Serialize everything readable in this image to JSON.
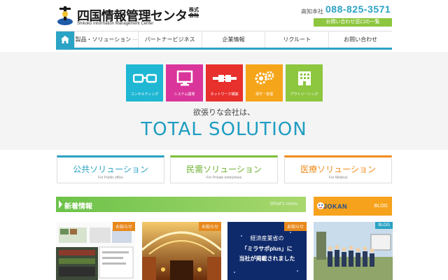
{
  "header": {
    "logo_title": "四国情報管理センター",
    "logo_kabushiki": "株式会社",
    "logo_subtitle": "Shikoku Information Management Center",
    "tel_label": "高知本社",
    "tel_number": "088-825-3571",
    "contact_button": "お問い合わせ窓口の一覧"
  },
  "nav": {
    "home_icon": "home-icon",
    "items": [
      {
        "label": "製品・ソリューション",
        "dash": "—"
      },
      {
        "label": "パートナービジネス",
        "dash": ""
      },
      {
        "label": "企業情報",
        "dash": ""
      },
      {
        "label": "リクルート",
        "dash": ""
      },
      {
        "label": "お問い合わせ",
        "dash": ""
      }
    ]
  },
  "hero": {
    "tiles": [
      {
        "label": "コンサルティング",
        "color": "#1fb7d3",
        "icon": "glasses-icon"
      },
      {
        "label": "システム開発",
        "color": "#d9359a",
        "icon": "monitor-icon"
      },
      {
        "label": "ネットワーク構築",
        "color": "#e8302c",
        "icon": "network-plug-icon"
      },
      {
        "label": "保守・管理",
        "color": "#f5a51a",
        "icon": "gears-icon"
      },
      {
        "label": "アウトソーシング",
        "color": "#8dc63f",
        "icon": "building-icon"
      }
    ],
    "tagline": "欲張りな会社は、",
    "headline": "TOTAL SOLUTION"
  },
  "solutions": [
    {
      "name": "公共ソリューション",
      "sub": "For Public office",
      "color": "#2aa3c4"
    },
    {
      "name": "民需ソリューション",
      "sub": "For Private enterprises",
      "color": "#7cbf3a"
    },
    {
      "name": "医療ソリューション",
      "sub": "For Medical",
      "color": "#f08c1c"
    }
  ],
  "news": {
    "title": "新着情報",
    "subtitle": "What's news"
  },
  "blog_banner": {
    "brand": "JOKAN",
    "label": "BLOG"
  },
  "thumbs": [
    {
      "badge": "お知らせ"
    },
    {
      "badge": "お知らせ"
    },
    {
      "badge": "お知らせ",
      "line1": "経済産業省の",
      "line2": "「ミラサポplus」に",
      "line3": "当社が掲載されました"
    },
    {
      "badge": "BLOG"
    }
  ]
}
